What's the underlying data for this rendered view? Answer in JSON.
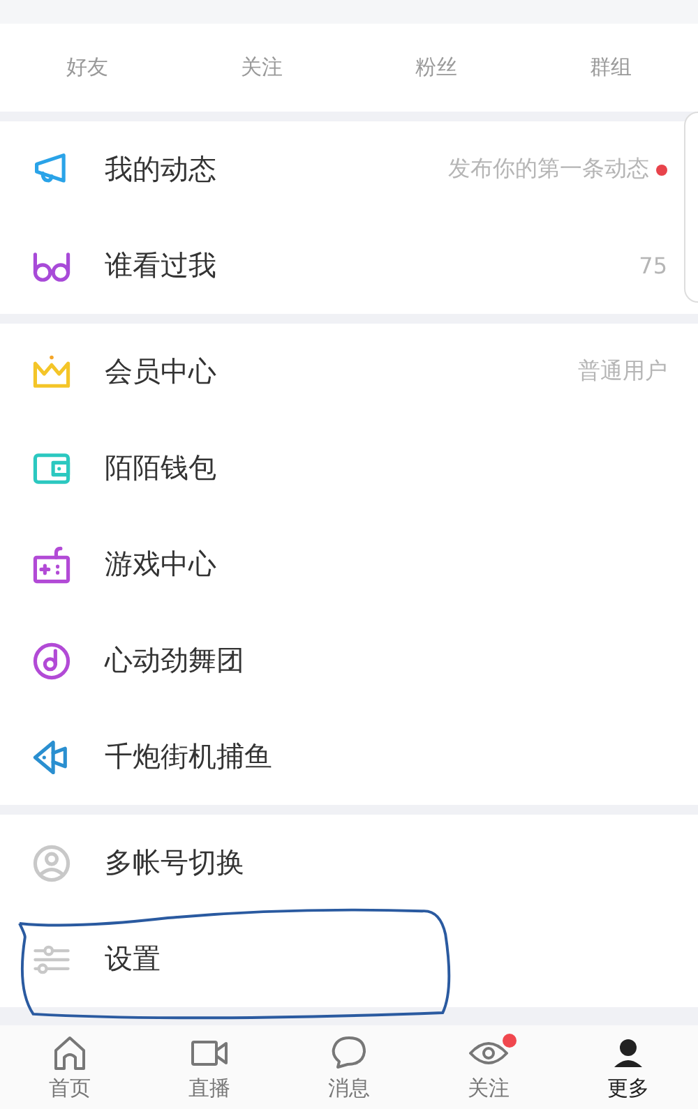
{
  "stats": [
    {
      "label": "好友"
    },
    {
      "label": "关注"
    },
    {
      "label": "粉丝"
    },
    {
      "label": "群组"
    }
  ],
  "sections": [
    {
      "items": [
        {
          "kind": "megaphone",
          "label": "我的动态",
          "value": "发布你的第一条动态",
          "dot": true
        },
        {
          "kind": "glasses",
          "label": "谁看过我",
          "value": "75",
          "dot": false
        }
      ]
    },
    {
      "items": [
        {
          "kind": "crown",
          "label": "会员中心",
          "value": "普通用户",
          "dot": false
        },
        {
          "kind": "wallet",
          "label": "陌陌钱包",
          "dot": false
        },
        {
          "kind": "gamepad",
          "label": "游戏中心",
          "dot": false
        },
        {
          "kind": "music",
          "label": "心动劲舞团",
          "dot": false
        },
        {
          "kind": "fish",
          "label": "千炮街机捕鱼",
          "dot": false
        }
      ]
    },
    {
      "items": [
        {
          "kind": "user",
          "label": "多帐号切换",
          "dot": false
        },
        {
          "kind": "sliders",
          "label": "设置",
          "dot": false
        }
      ]
    }
  ],
  "tabs": [
    {
      "kind": "home",
      "label": "首页",
      "selected": false,
      "badge": false
    },
    {
      "kind": "video",
      "label": "直播",
      "selected": false,
      "badge": false
    },
    {
      "kind": "chat",
      "label": "消息",
      "selected": false,
      "badge": false
    },
    {
      "kind": "eye",
      "label": "关注",
      "selected": false,
      "badge": true
    },
    {
      "kind": "avatar",
      "label": "更多",
      "selected": true,
      "badge": false
    }
  ]
}
